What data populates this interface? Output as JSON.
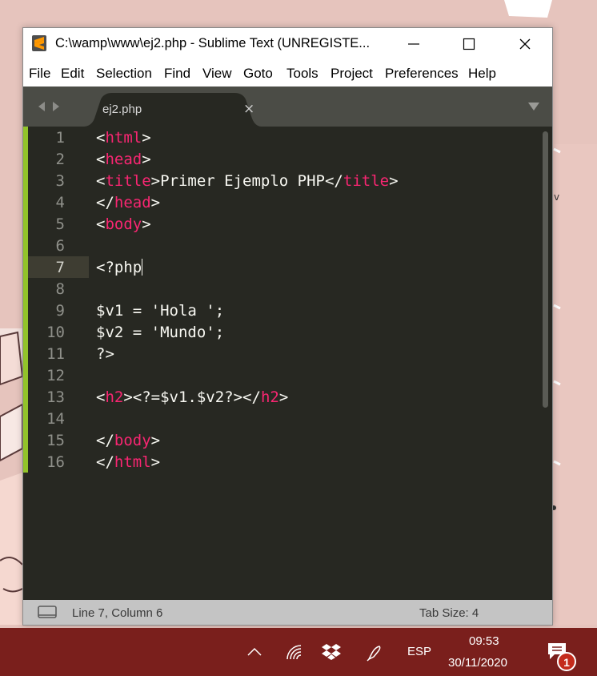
{
  "window": {
    "title": "C:\\wamp\\www\\ej2.php - Sublime Text (UNREGISTE...",
    "controls": {
      "minimize": "—",
      "maximize": "☐",
      "close": "✕"
    }
  },
  "menu": [
    "File",
    "Edit",
    "Selection",
    "Find",
    "View",
    "Goto",
    "Tools",
    "Project",
    "Preferences",
    "Help"
  ],
  "tabs": [
    {
      "label": "ej2.php",
      "close": "×"
    }
  ],
  "editor": {
    "current_line": 7,
    "lines": [
      {
        "n": "1",
        "parts": [
          [
            "p",
            "<"
          ],
          [
            "t",
            "html"
          ],
          [
            "p",
            ">"
          ]
        ]
      },
      {
        "n": "2",
        "parts": [
          [
            "p",
            "<"
          ],
          [
            "t",
            "head"
          ],
          [
            "p",
            ">"
          ]
        ]
      },
      {
        "n": "3",
        "parts": [
          [
            "p",
            "<"
          ],
          [
            "t",
            "title"
          ],
          [
            "p",
            ">Primer Ejemplo PHP</"
          ],
          [
            "t",
            "title"
          ],
          [
            "p",
            ">"
          ]
        ]
      },
      {
        "n": "4",
        "parts": [
          [
            "p",
            "</"
          ],
          [
            "t",
            "head"
          ],
          [
            "p",
            ">"
          ]
        ]
      },
      {
        "n": "5",
        "parts": [
          [
            "p",
            "<"
          ],
          [
            "t",
            "body"
          ],
          [
            "p",
            ">"
          ]
        ]
      },
      {
        "n": "6",
        "parts": []
      },
      {
        "n": "7",
        "parts": [
          [
            "p",
            "<?php"
          ]
        ]
      },
      {
        "n": "8",
        "parts": []
      },
      {
        "n": "9",
        "parts": [
          [
            "p",
            "$v1 = 'Hola ';"
          ]
        ]
      },
      {
        "n": "10",
        "parts": [
          [
            "p",
            "$v2 = 'Mundo';"
          ]
        ]
      },
      {
        "n": "11",
        "parts": [
          [
            "p",
            "?>"
          ]
        ]
      },
      {
        "n": "12",
        "parts": []
      },
      {
        "n": "13",
        "parts": [
          [
            "p",
            "<"
          ],
          [
            "t",
            "h2"
          ],
          [
            "p",
            "><?=$v1.$v2?></"
          ],
          [
            "t",
            "h2"
          ],
          [
            "p",
            ">"
          ]
        ]
      },
      {
        "n": "14",
        "parts": []
      },
      {
        "n": "15",
        "parts": [
          [
            "p",
            "</"
          ],
          [
            "t",
            "body"
          ],
          [
            "p",
            ">"
          ]
        ]
      },
      {
        "n": "16",
        "parts": [
          [
            "p",
            "</"
          ],
          [
            "t",
            "html"
          ],
          [
            "p",
            ">"
          ]
        ]
      }
    ]
  },
  "status": {
    "position": "Line 7, Column 6",
    "tab_size": "Tab Size: 4"
  },
  "taskbar": {
    "language": "ESP",
    "time": "09:53",
    "date": "30/11/2020",
    "notification_count": "1"
  },
  "colors": {
    "editor_bg": "#272822",
    "tag": "#f92672",
    "text": "#f8f8f2",
    "gutter_marker": "#92c32a",
    "taskbar": "#7a1f1c",
    "accent_sublime": "#ff9800"
  }
}
